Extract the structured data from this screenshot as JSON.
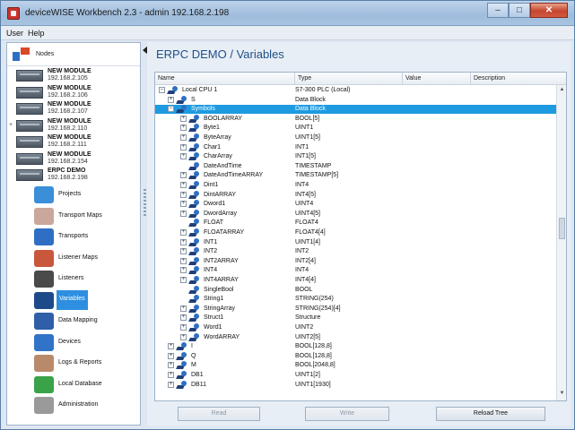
{
  "window": {
    "title": "deviceWISE Workbench 2.3  -  admin 192.168.2.198",
    "controls": {
      "minimize": "–",
      "maximize": "□",
      "close": "✕"
    }
  },
  "menubar": [
    "User",
    "Help"
  ],
  "nodes": {
    "header": "Nodes",
    "items": [
      {
        "name": "NEW MODULE",
        "ip": "192.168.2.105"
      },
      {
        "name": "NEW MODULE",
        "ip": "192.168.2.106"
      },
      {
        "name": "NEW MODULE",
        "ip": "192.168.2.107"
      },
      {
        "name": "NEW MODULE",
        "ip": "192.168.2.110"
      },
      {
        "name": "NEW MODULE",
        "ip": "192.168.2.111"
      },
      {
        "name": "NEW MODULE",
        "ip": "192.168.2.154"
      },
      {
        "name": "ERPC DEMO",
        "ip": "192.168.2.198"
      }
    ]
  },
  "nav": [
    {
      "label": "Projects",
      "icon": "database-icon",
      "color": "#3a8fd8"
    },
    {
      "label": "Transport Maps",
      "icon": "globe-icon",
      "color": "#c9a79a"
    },
    {
      "label": "Transports",
      "icon": "transport-arrows-icon",
      "color": "#2e6fc4"
    },
    {
      "label": "Listener Maps",
      "icon": "listener-map-icon",
      "color": "#c8573c"
    },
    {
      "label": "Listeners",
      "icon": "headphones-icon",
      "color": "#4a4a4a"
    },
    {
      "label": "Variables",
      "icon": "variables-icon",
      "color": "#1f4a8a",
      "selected": true
    },
    {
      "label": "Data Mapping",
      "icon": "data-mapping-icon",
      "color": "#2e5fa8"
    },
    {
      "label": "Devices",
      "icon": "devices-icon",
      "color": "#3173c6"
    },
    {
      "label": "Logs & Reports",
      "icon": "logs-icon",
      "color": "#b98a6a"
    },
    {
      "label": "Local Database",
      "icon": "local-database-icon",
      "color": "#3aa34a"
    },
    {
      "label": "Administration",
      "icon": "administration-icon",
      "color": "#9a9a9a"
    }
  ],
  "main": {
    "title": "ERPC DEMO / Variables",
    "columns": [
      "Name",
      "Type",
      "Value",
      "Description"
    ],
    "rows": [
      {
        "name": "Local CPU 1",
        "type": "S7-300 PLC (Local)",
        "level": 0,
        "exp": "–"
      },
      {
        "name": "S",
        "type": "Data Block",
        "level": 1,
        "exp": "+"
      },
      {
        "name": "Symbols",
        "type": "Data Block",
        "level": 1,
        "exp": "–",
        "selected": true
      },
      {
        "name": "BOOLARRAY",
        "type": "BOOL[5]",
        "level": 2,
        "exp": "+"
      },
      {
        "name": "Byte1",
        "type": "UINT1",
        "level": 2,
        "exp": "+"
      },
      {
        "name": "ByteArray",
        "type": "UINT1[5]",
        "level": 2,
        "exp": "+"
      },
      {
        "name": "Char1",
        "type": "INT1",
        "level": 2,
        "exp": "+"
      },
      {
        "name": "CharArray",
        "type": "INT1[5]",
        "level": 2,
        "exp": "+"
      },
      {
        "name": "DateAndTime",
        "type": "TIMESTAMP",
        "level": 2,
        "exp": ""
      },
      {
        "name": "DateAndTimeARRAY",
        "type": "TIMESTAMP[5]",
        "level": 2,
        "exp": "+"
      },
      {
        "name": "Dint1",
        "type": "INT4",
        "level": 2,
        "exp": "+"
      },
      {
        "name": "DintARRAY",
        "type": "INT4[5]",
        "level": 2,
        "exp": "+"
      },
      {
        "name": "Dword1",
        "type": "UINT4",
        "level": 2,
        "exp": "+"
      },
      {
        "name": "DwordArray",
        "type": "UINT4[5]",
        "level": 2,
        "exp": "+"
      },
      {
        "name": "FLOAT",
        "type": "FLOAT4",
        "level": 2,
        "exp": ""
      },
      {
        "name": "FLOATARRAY",
        "type": "FLOAT4[4]",
        "level": 2,
        "exp": "+"
      },
      {
        "name": "INT1",
        "type": "UINT1[4]",
        "level": 2,
        "exp": "+"
      },
      {
        "name": "INT2",
        "type": "INT2",
        "level": 2,
        "exp": "+"
      },
      {
        "name": "INT2ARRAY",
        "type": "INT2[4]",
        "level": 2,
        "exp": "+"
      },
      {
        "name": "INT4",
        "type": "INT4",
        "level": 2,
        "exp": "+"
      },
      {
        "name": "INT4ARRAY",
        "type": "INT4[4]",
        "level": 2,
        "exp": "+"
      },
      {
        "name": "SingleBool",
        "type": "BOOL",
        "level": 2,
        "exp": ""
      },
      {
        "name": "String1",
        "type": "STRING(254)",
        "level": 2,
        "exp": ""
      },
      {
        "name": "StringArray",
        "type": "STRING(254)[4]",
        "level": 2,
        "exp": "+"
      },
      {
        "name": "Struct1",
        "type": "Structure",
        "level": 2,
        "exp": "+"
      },
      {
        "name": "Word1",
        "type": "UINT2",
        "level": 2,
        "exp": "+"
      },
      {
        "name": "WordARRAY",
        "type": "UINT2[5]",
        "level": 2,
        "exp": "+"
      },
      {
        "name": "I",
        "type": "BOOL[128,8]",
        "level": 1,
        "exp": "+"
      },
      {
        "name": "Q",
        "type": "BOOL[128,8]",
        "level": 1,
        "exp": "+"
      },
      {
        "name": "M",
        "type": "BOOL[2048,8]",
        "level": 1,
        "exp": "+"
      },
      {
        "name": "DB1",
        "type": "UINT1[2]",
        "level": 1,
        "exp": "+"
      },
      {
        "name": "DB11",
        "type": "UINT1[1930]",
        "level": 1,
        "exp": "+"
      }
    ],
    "buttons": {
      "read": "Read",
      "write": "Write",
      "reload": "Reload Tree"
    }
  }
}
